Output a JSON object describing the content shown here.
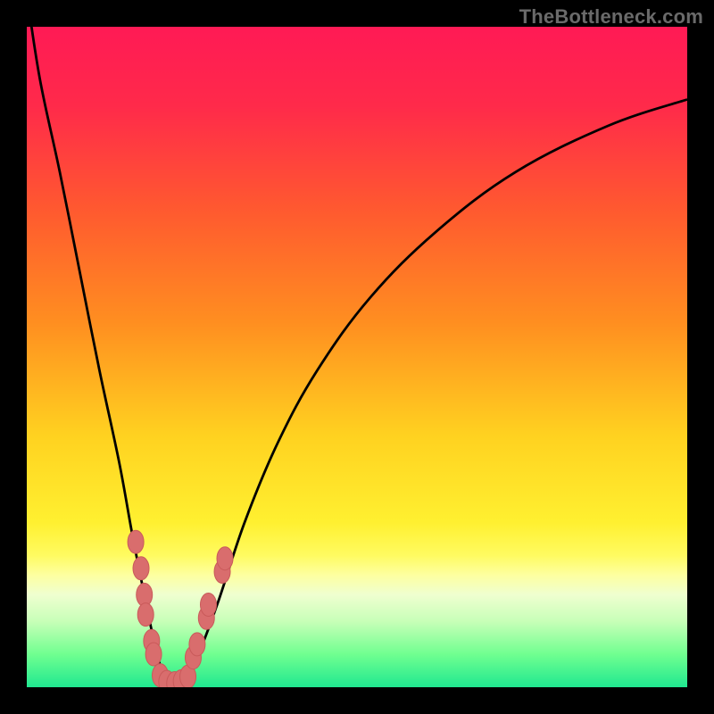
{
  "watermark": "TheBottleneck.com",
  "colors": {
    "frame": "#000000",
    "gradient_stops": [
      {
        "pct": 0,
        "color": "#ff1a55"
      },
      {
        "pct": 12,
        "color": "#ff2a4a"
      },
      {
        "pct": 28,
        "color": "#ff5a2f"
      },
      {
        "pct": 45,
        "color": "#ff8f20"
      },
      {
        "pct": 62,
        "color": "#ffd220"
      },
      {
        "pct": 75,
        "color": "#fff030"
      },
      {
        "pct": 80,
        "color": "#fffb60"
      },
      {
        "pct": 83,
        "color": "#fdffa0"
      },
      {
        "pct": 86,
        "color": "#efffd0"
      },
      {
        "pct": 90,
        "color": "#c8ffb8"
      },
      {
        "pct": 95,
        "color": "#70ff90"
      },
      {
        "pct": 100,
        "color": "#20e890"
      }
    ],
    "curve": "#000000",
    "marker_fill": "#d96d6d",
    "marker_stroke": "#c95a5a"
  },
  "chart_data": {
    "type": "line",
    "title": "",
    "xlabel": "",
    "ylabel": "",
    "xlim": [
      0,
      100
    ],
    "ylim": [
      0,
      100
    ],
    "series": [
      {
        "name": "bottleneck-curve",
        "x": [
          0,
          2,
          5,
          8,
          11,
          14,
          16,
          18,
          19.5,
          21,
          22.5,
          24,
          26,
          29,
          33,
          38,
          44,
          52,
          62,
          74,
          88,
          100
        ],
        "y": [
          105,
          92,
          78,
          63,
          48,
          34,
          23,
          13,
          6,
          1,
          0.5,
          1,
          5,
          13,
          25,
          37,
          48,
          59,
          69,
          78,
          85,
          89
        ]
      }
    ],
    "markers": {
      "name": "sample-dots-near-minimum",
      "points": [
        {
          "x": 16.5,
          "y": 22
        },
        {
          "x": 17.3,
          "y": 18
        },
        {
          "x": 17.8,
          "y": 14
        },
        {
          "x": 18.0,
          "y": 11
        },
        {
          "x": 18.9,
          "y": 7
        },
        {
          "x": 19.2,
          "y": 5
        },
        {
          "x": 20.2,
          "y": 1.8
        },
        {
          "x": 21.2,
          "y": 0.8
        },
        {
          "x": 22.4,
          "y": 0.6
        },
        {
          "x": 23.4,
          "y": 0.9
        },
        {
          "x": 24.4,
          "y": 1.6
        },
        {
          "x": 25.2,
          "y": 4.5
        },
        {
          "x": 25.8,
          "y": 6.5
        },
        {
          "x": 27.2,
          "y": 10.5
        },
        {
          "x": 27.5,
          "y": 12.5
        },
        {
          "x": 29.6,
          "y": 17.5
        },
        {
          "x": 30.0,
          "y": 19.5
        }
      ]
    }
  }
}
